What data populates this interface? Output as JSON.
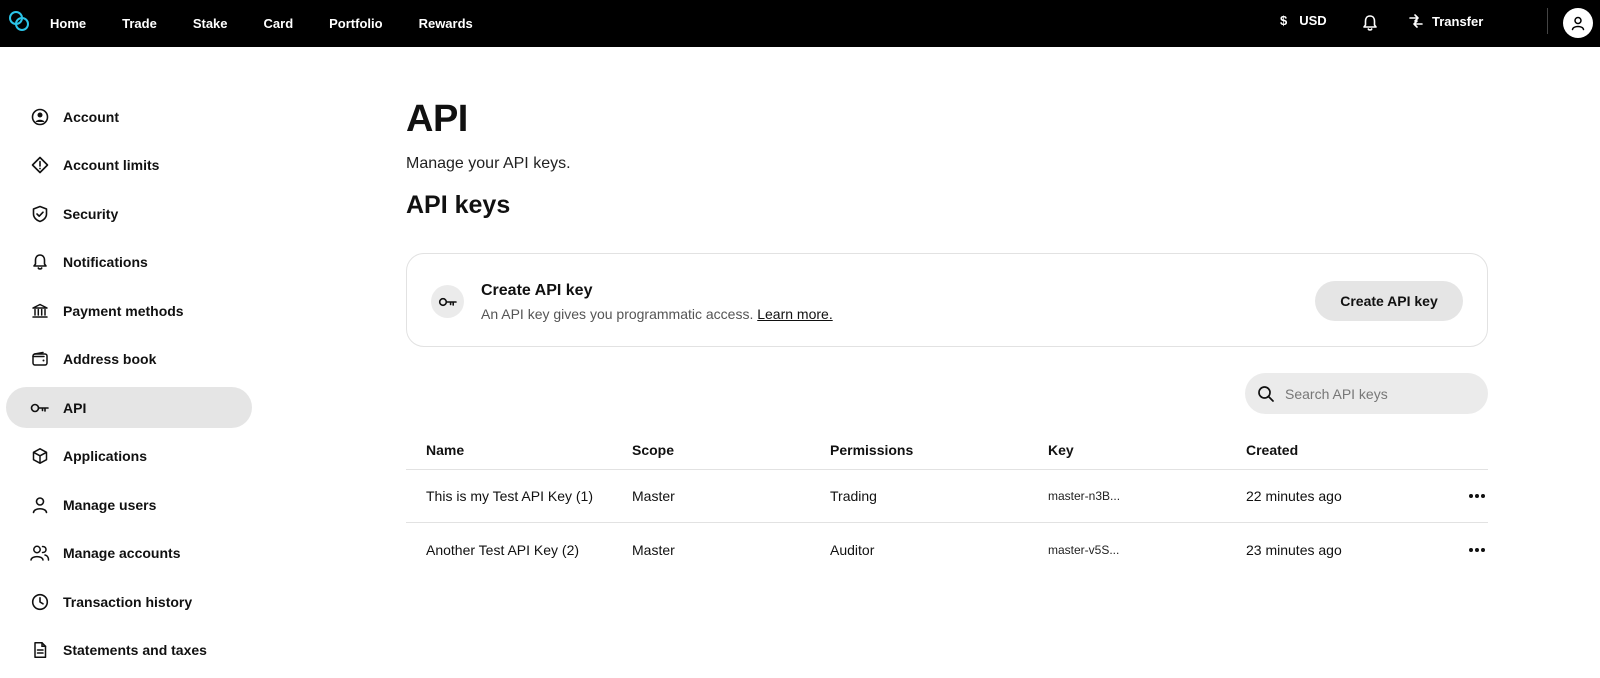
{
  "topnav": {
    "items": [
      {
        "label": "Home"
      },
      {
        "label": "Trade"
      },
      {
        "label": "Stake"
      },
      {
        "label": "Card"
      },
      {
        "label": "Portfolio"
      },
      {
        "label": "Rewards"
      }
    ],
    "currency_symbol": "$",
    "currency": "USD",
    "transfer_label": "Transfer"
  },
  "sidebar": {
    "items": [
      {
        "label": "Account",
        "icon": "user-circle-icon"
      },
      {
        "label": "Account limits",
        "icon": "warning-diamond-icon"
      },
      {
        "label": "Security",
        "icon": "shield-check-icon"
      },
      {
        "label": "Notifications",
        "icon": "bell-icon"
      },
      {
        "label": "Payment methods",
        "icon": "bank-icon"
      },
      {
        "label": "Address book",
        "icon": "wallet-icon"
      },
      {
        "label": "API",
        "icon": "key-icon",
        "active": true
      },
      {
        "label": "Applications",
        "icon": "cube-icon"
      },
      {
        "label": "Manage users",
        "icon": "user-icon"
      },
      {
        "label": "Manage accounts",
        "icon": "users-icon"
      },
      {
        "label": "Transaction history",
        "icon": "clock-icon"
      },
      {
        "label": "Statements and taxes",
        "icon": "document-icon"
      }
    ]
  },
  "main": {
    "title": "API",
    "subtitle": "Manage your API keys.",
    "section_title": "API keys",
    "create_card": {
      "title": "Create API key",
      "description": "An API key gives you programmatic access.",
      "learn_more": "Learn more.",
      "button_label": "Create API key"
    },
    "search": {
      "placeholder": "Search API keys",
      "value": ""
    },
    "table": {
      "columns": [
        "Name",
        "Scope",
        "Permissions",
        "Key",
        "Created"
      ],
      "rows": [
        {
          "name": "This is my Test API Key (1)",
          "scope": "Master",
          "permissions": "Trading",
          "key": "master-n3B...",
          "created": "22 minutes ago"
        },
        {
          "name": "Another Test API Key (2)",
          "scope": "Master",
          "permissions": "Auditor",
          "key": "master-v5S...",
          "created": "23 minutes ago"
        }
      ]
    }
  }
}
